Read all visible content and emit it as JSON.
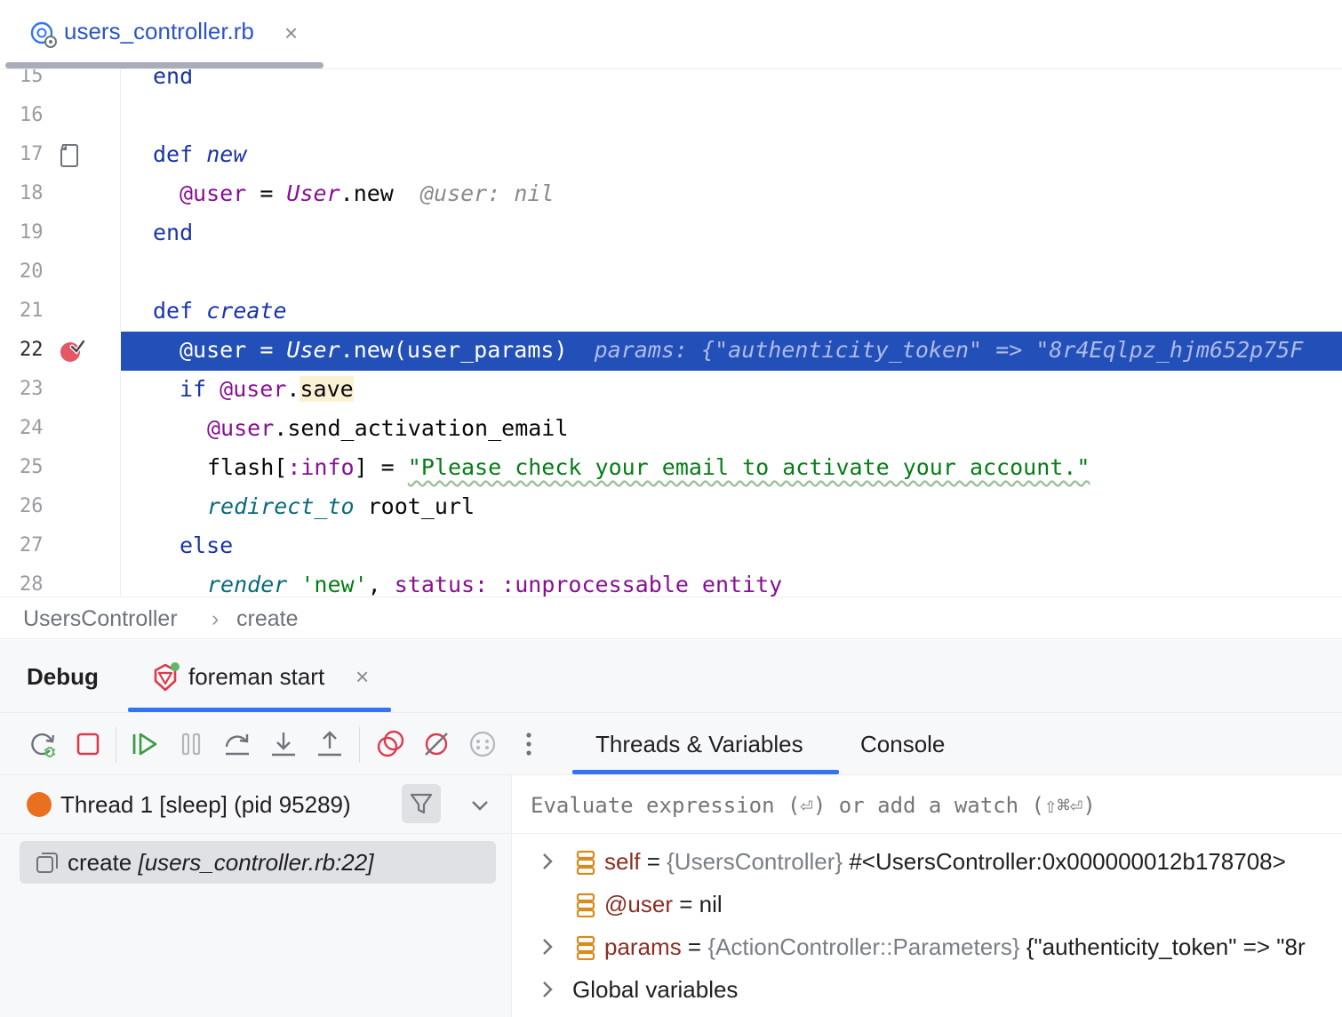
{
  "editor_tab": {
    "filename": "users_controller.rb",
    "close": "×"
  },
  "code_lines": [
    {
      "num": "15"
    },
    {
      "num": "16"
    },
    {
      "num": "17"
    },
    {
      "num": "18"
    },
    {
      "num": "19"
    },
    {
      "num": "20"
    },
    {
      "num": "21"
    },
    {
      "num": "22"
    },
    {
      "num": "23"
    },
    {
      "num": "24"
    },
    {
      "num": "25"
    },
    {
      "num": "26"
    },
    {
      "num": "27"
    },
    {
      "num": "28"
    }
  ],
  "code": {
    "l15_end": "end",
    "l17_def": "def ",
    "l17_name": "new",
    "l18_ivar": "@user",
    "l18_eq": " = ",
    "l18_cls": "User",
    "l18_call": ".new",
    "l18_hint": "@user: nil",
    "l19_end": "end",
    "l21_def": "def ",
    "l21_name": "create",
    "l22_ivar": "@user",
    "l22_eq": " = ",
    "l22_cls": "User",
    "l22_call": ".new(user_params)",
    "l22_hint": "params: {\"authenticity_token\" => \"8r4Eqlpz_hjm652p75F",
    "l23_if": "if ",
    "l23_ivar": "@user",
    "l23_dot": ".",
    "l23_save": "save",
    "l24_ivar": "@user",
    "l24_call": ".send_activation_email",
    "l25_flash": "flash[",
    "l25_sym": ":info",
    "l25_mid": "] = ",
    "l25_str": "\"Please check your email to activate your account.\"",
    "l26_meth": "redirect_to",
    "l26_rest": " root_url",
    "l27_else": "else",
    "l28_meth": "render",
    "l28_str": "'new'",
    "l28_comma": ", ",
    "l28_key": "status:",
    "l28_sym": " :unprocessable_entity"
  },
  "breadcrumb": {
    "class_name": "UsersController",
    "separator": "›",
    "method": "create"
  },
  "debug": {
    "title": "Debug",
    "run_config": "foreman start",
    "close": "×",
    "tabs": {
      "threads_variables": "Threads & Variables",
      "console": "Console"
    }
  },
  "toolbar_icons": [
    "rerun-icon",
    "stop-icon",
    "resume-icon",
    "pause-icon",
    "step-over-icon",
    "step-into-icon",
    "step-out-icon",
    "view-breakpoints-icon",
    "mute-breakpoints-icon",
    "more-settings-icon",
    "more-options-icon"
  ],
  "thread": {
    "label": "Thread 1 [sleep] (pid 95289)"
  },
  "frame": {
    "method": "create ",
    "location": "[users_controller.rb:22]"
  },
  "eval": {
    "placeholder": "Evaluate expression (⏎) or add a watch (⇧⌘⏎)"
  },
  "variables": [
    {
      "name": "self",
      "eq": " = ",
      "type": "{UsersController}",
      "value": " #<UsersController:0x000000012b178708>"
    },
    {
      "name": "@user",
      "eq": " = ",
      "type": "",
      "value": "nil"
    },
    {
      "name": "params",
      "eq": " = ",
      "type": "{ActionController::Parameters}",
      "value": " {\"authenticity_token\" => \"8r"
    }
  ],
  "globals": {
    "label": "Global variables"
  },
  "colors": {
    "accent": "#3574f0",
    "exec_line": "#2350b8",
    "keyword": "#1a34a5",
    "instance_var": "#871094",
    "string": "#067d17",
    "thread_status": "#e8701e",
    "breakpoint": "#e55765"
  }
}
